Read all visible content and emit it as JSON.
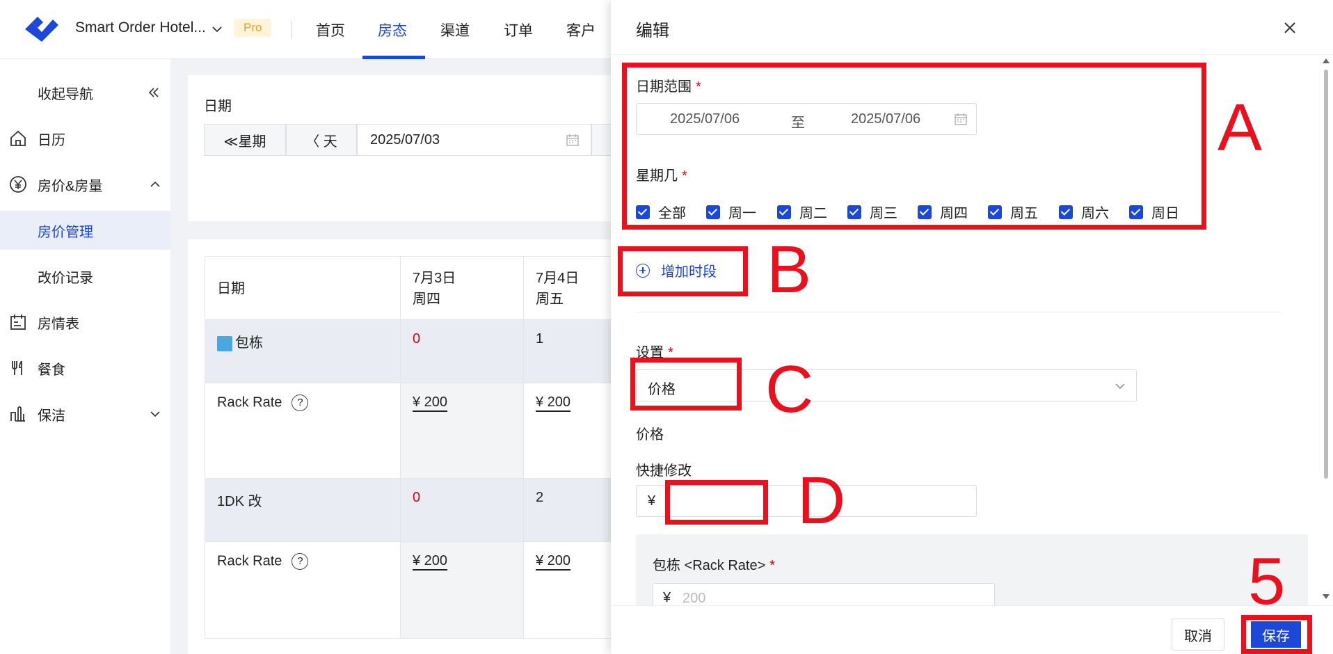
{
  "header": {
    "hotel_name": "Smart Order Hotel...",
    "badge": "Pro",
    "nav": [
      "首页",
      "房态",
      "渠道",
      "订单",
      "客户"
    ]
  },
  "sidebar": {
    "collapse_label": "收起导航",
    "items": [
      {
        "label": "日历",
        "icon": "home-icon"
      },
      {
        "label": "房价&房量",
        "icon": "yen-icon"
      },
      {
        "label": "房价管理"
      },
      {
        "label": "改价记录"
      },
      {
        "label": "房情表",
        "icon": "calendar-icon"
      },
      {
        "label": "餐食",
        "icon": "utensils-icon"
      },
      {
        "label": "保洁",
        "icon": "cleaning-icon"
      }
    ]
  },
  "filter": {
    "label": "日期",
    "prev_week": "≪星期",
    "prev_day": "〈 天",
    "date": "2025/07/03"
  },
  "table": {
    "header": {
      "col0": "日期",
      "col1_date": "7月3日",
      "col1_day": "周四",
      "col2_date": "7月4日",
      "col2_day": "周五"
    },
    "rows": [
      {
        "label": "包栋",
        "v1": "0",
        "v2": "1"
      },
      {
        "label": "Rack Rate",
        "v1": "¥ 200",
        "v2": "¥ 200"
      },
      {
        "label": "1DK 改",
        "v1": "0",
        "v2": "2"
      },
      {
        "label": "Rack Rate",
        "v1": "¥ 200",
        "v2": "¥ 200"
      }
    ]
  },
  "drawer": {
    "title": "编辑",
    "date_range_label": "日期范围",
    "date_start": "2025/07/06",
    "date_sep": "至",
    "date_end": "2025/07/06",
    "weekday_label": "星期几",
    "weekdays": [
      "全部",
      "周一",
      "周二",
      "周三",
      "周四",
      "周五",
      "周六",
      "周日"
    ],
    "add_period": "增加时段",
    "setting_label": "设置",
    "setting_value": "价格",
    "price_label": "价格",
    "quick_edit_label": "快捷修改",
    "quick_edit_prefix": "¥",
    "panel_label": "包栋 <Rack Rate>",
    "panel_prefix": "¥",
    "panel_placeholder": "200",
    "cancel": "取消",
    "save": "保存",
    "required_mark": "*"
  },
  "annotations": [
    "A",
    "B",
    "C",
    "D",
    "5"
  ],
  "colors": {
    "accent": "#1c48d9",
    "annotation": "#e8121e",
    "error": "#e0001a"
  }
}
